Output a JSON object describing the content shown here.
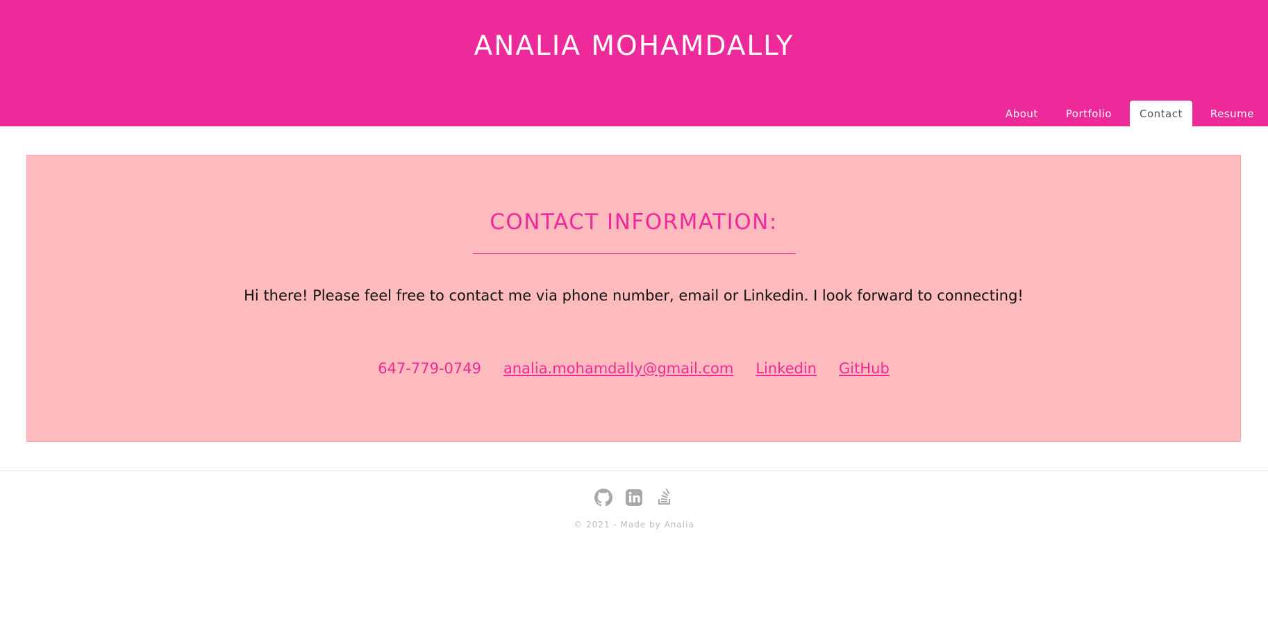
{
  "header": {
    "site_title": "ANALIA MOHAMDALLY",
    "nav": [
      {
        "label": "About",
        "active": false
      },
      {
        "label": "Portfolio",
        "active": false
      },
      {
        "label": "Contact",
        "active": true
      },
      {
        "label": "Resume",
        "active": false
      }
    ]
  },
  "contact": {
    "title": "CONTACT INFORMATION:",
    "intro": "Hi there! Please feel free to contact me via phone number, email or Linkedin. I look forward to connecting!",
    "phone": "647-779-0749",
    "email": "analia.mohamdally@gmail.com",
    "linkedin_label": "Linkedin",
    "github_label": "GitHub"
  },
  "footer": {
    "icons": [
      "github-icon",
      "linkedin-icon",
      "stackoverflow-icon"
    ],
    "copyright": "© 2021 - Made by Analia"
  },
  "colors": {
    "brand_pink": "#ee2999",
    "panel_pink": "#fdbbbd",
    "footer_icon": "#a9a9a9"
  }
}
